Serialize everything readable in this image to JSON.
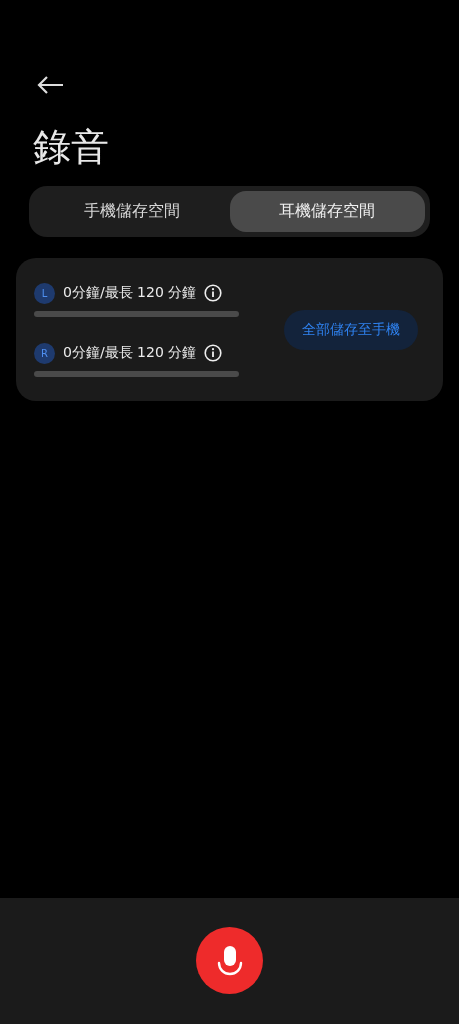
{
  "title": "錄音",
  "tabs": [
    {
      "label": "手機儲存空間",
      "selected": false
    },
    {
      "label": "耳機儲存空間",
      "selected": true
    }
  ],
  "earbuds": [
    {
      "badge": "L",
      "usage": "0分鐘/最長 120 分鐘",
      "level": 0
    },
    {
      "badge": "R",
      "usage": "0分鐘/最長 120 分鐘",
      "level": 0
    }
  ],
  "save_button": "全部儲存至手機"
}
